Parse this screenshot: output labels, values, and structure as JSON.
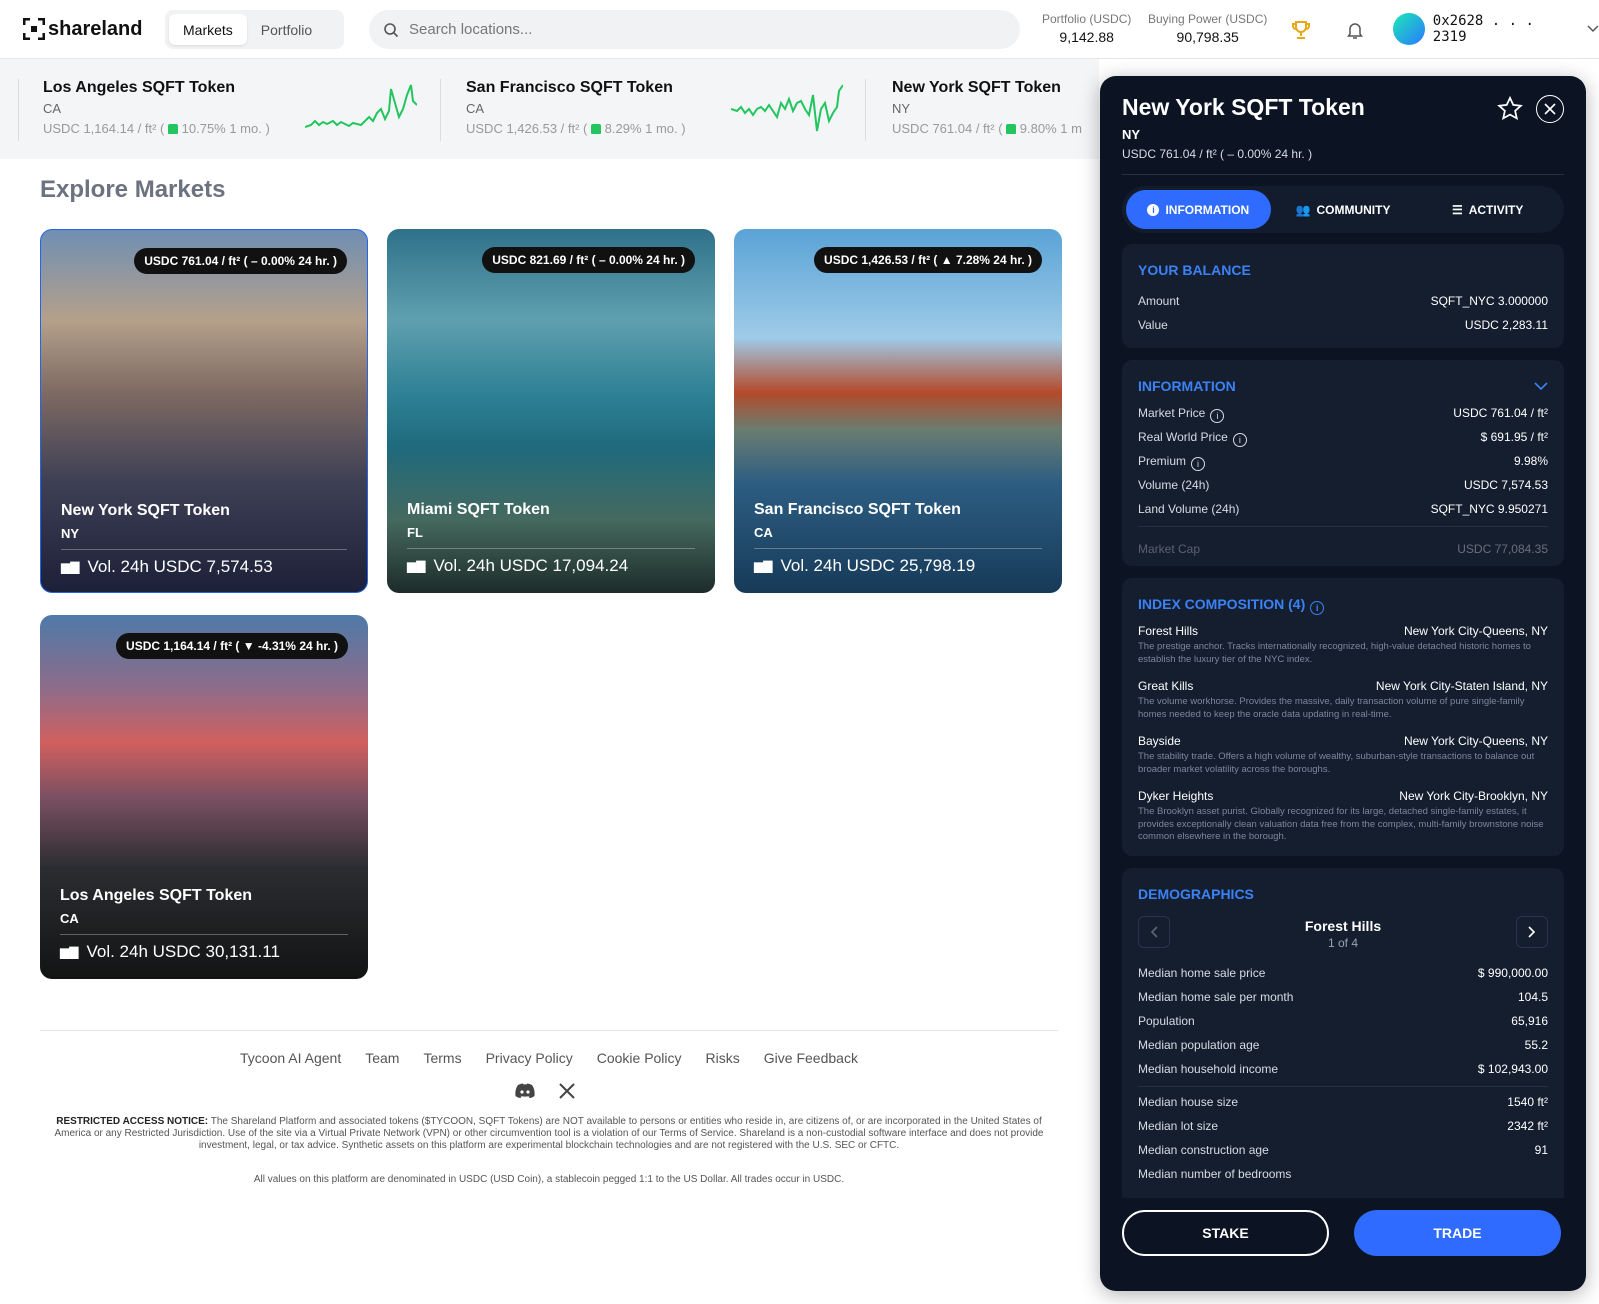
{
  "brand": {
    "logo_text": "shareland"
  },
  "nav": {
    "tabs": [
      "Markets",
      "Portfolio"
    ]
  },
  "search": {
    "placeholder": "Search locations..."
  },
  "header": {
    "portfolio_label": "Portfolio (USDC)",
    "portfolio_value": "9,142.88",
    "buying_power_label": "Buying Power (USDC)",
    "buying_power_value": "90,798.35",
    "wallet_address": "0x2628 . . . 2319"
  },
  "ticker": [
    {
      "name": "Los Angeles SQFT Token",
      "state": "CA",
      "price": "USDC 1,164.14 / ft² (",
      "change": "10.75% 1 mo. )"
    },
    {
      "name": "San Francisco SQFT Token",
      "state": "CA",
      "price": "USDC 1,426.53 / ft² (",
      "change": "8.29% 1 mo. )"
    },
    {
      "name": "New York SQFT Token",
      "state": "NY",
      "price": "USDC 761.04 / ft² (",
      "change": "9.80% 1 m"
    }
  ],
  "explore": {
    "title": "Explore Markets"
  },
  "cards": [
    {
      "badge": "USDC 761.04 / ft² ( – 0.00% 24 hr. )",
      "name": "New York SQFT Token",
      "state": "NY",
      "vol": "Vol. 24h USDC 7,574.53"
    },
    {
      "badge": "USDC 821.69 / ft² ( – 0.00% 24 hr. )",
      "name": "Miami SQFT Token",
      "state": "FL",
      "vol": "Vol. 24h USDC 17,094.24"
    },
    {
      "badge": "USDC 1,426.53 / ft² ( ▲ 7.28% 24 hr. )",
      "name": "San Francisco SQFT Token",
      "state": "CA",
      "vol": "Vol. 24h USDC 25,798.19"
    },
    {
      "badge": "USDC 1,164.14 / ft² ( ▼ -4.31% 24 hr. )",
      "name": "Los Angeles SQFT Token",
      "state": "CA",
      "vol": "Vol. 24h USDC 30,131.11"
    }
  ],
  "footer": {
    "links": [
      "Tycoon AI Agent",
      "Team",
      "Terms",
      "Privacy Policy",
      "Cookie Policy",
      "Risks",
      "Give Feedback"
    ],
    "notice_bold": "RESTRICTED ACCESS NOTICE:",
    "notice": "The Shareland Platform and associated tokens ($TYCOON, SQFT Tokens) are NOT available to persons or entities who reside in, are citizens of, or are incorporated in the United States of America or any Restricted Jurisdiction. Use of the site via a Virtual Private Network (VPN) or other circumvention tool is a violation of our Terms of Service. Shareland is a non-custodial software interface and does not provide investment, legal, or tax advice. Synthetic assets on this platform are experimental blockchain technologies and are not registered with the U.S. SEC or CFTC.",
    "denomination": "All values on this platform are denominated in USDC (USD Coin), a stablecoin pegged 1:1 to the US Dollar. All trades occur in USDC."
  },
  "panel": {
    "title": "New York SQFT Token",
    "state": "NY",
    "price": "USDC 761.04 / ft² ( – 0.00% 24 hr. )",
    "tabs": [
      "INFORMATION",
      "COMMUNITY",
      "ACTIVITY"
    ],
    "balance": {
      "title": "YOUR BALANCE",
      "rows": [
        {
          "label": "Amount",
          "value": "SQFT_NYC 3.000000"
        },
        {
          "label": "Value",
          "value": "USDC 2,283.11"
        }
      ]
    },
    "information": {
      "title": "INFORMATION",
      "rows": [
        {
          "label": "Market Price",
          "value": "USDC 761.04 / ft²"
        },
        {
          "label": "Real World Price",
          "value": "$ 691.95 / ft²"
        },
        {
          "label": "Premium",
          "value": "9.98%"
        },
        {
          "label": "Volume (24h)",
          "value": "USDC 7,574.53"
        },
        {
          "label": "Land Volume (24h)",
          "value": "SQFT_NYC 9.950271"
        },
        {
          "label": "Market Cap",
          "value": "USDC 77,084.35"
        }
      ]
    },
    "composition": {
      "title": "INDEX COMPOSITION (4)",
      "items": [
        {
          "name": "Forest Hills",
          "location": "New York City-Queens, NY",
          "desc": "The prestige anchor. Tracks internationally recognized, high-value detached historic homes to establish the luxury tier of the NYC index."
        },
        {
          "name": "Great Kills",
          "location": "New York City-Staten Island, NY",
          "desc": "The volume workhorse. Provides the massive, daily transaction volume of pure single-family homes needed to keep the oracle data updating in real-time."
        },
        {
          "name": "Bayside",
          "location": "New York City-Queens, NY",
          "desc": "The stability trade. Offers a high volume of wealthy, suburban-style transactions to balance out broader market volatility across the boroughs."
        },
        {
          "name": "Dyker Heights",
          "location": "New York City-Brooklyn, NY",
          "desc": "The Brooklyn asset purist. Globally recognized for its large, detached single-family estates, it provides exceptionally clean valuation data free from the complex, multi-family brownstone noise common elsewhere in the borough."
        }
      ]
    },
    "demographics": {
      "title": "DEMOGRAPHICS",
      "current": "Forest Hills",
      "index": "1 of 4",
      "rows": [
        {
          "label": "Median home sale price",
          "value": "$ 990,000.00"
        },
        {
          "label": "Median home sale per month",
          "value": "104.5"
        },
        {
          "label": "Population",
          "value": "65,916"
        },
        {
          "label": "Median population age",
          "value": "55.2"
        },
        {
          "label": "Median household income",
          "value": "$ 102,943.00"
        },
        {
          "label": "Median house size",
          "value": "1540 ft²"
        },
        {
          "label": "Median lot size",
          "value": "2342 ft²"
        },
        {
          "label": "Median construction age",
          "value": "91"
        },
        {
          "label": "Median number of bedrooms",
          "value": ""
        }
      ]
    },
    "buttons": {
      "stake": "STAKE",
      "trade": "TRADE"
    }
  }
}
